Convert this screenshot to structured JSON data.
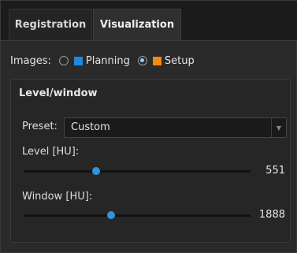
{
  "tabs": [
    {
      "label": "Registration",
      "active": false
    },
    {
      "label": "Visualization",
      "active": true
    }
  ],
  "images": {
    "label": "Images:",
    "options": [
      {
        "label": "Planning",
        "selected": false,
        "color": "#1e88e5"
      },
      {
        "label": "Setup",
        "selected": true,
        "color": "#f58a0a"
      }
    ]
  },
  "level_window": {
    "title": "Level/window",
    "preset": {
      "label": "Preset:",
      "value": "Custom"
    },
    "level": {
      "label": "Level [HU]:",
      "value": "551",
      "fraction": 0.32
    },
    "window": {
      "label": "Window [HU]:",
      "value": "1888",
      "fraction": 0.385
    }
  },
  "colors": {
    "accent": "#2f96de"
  }
}
